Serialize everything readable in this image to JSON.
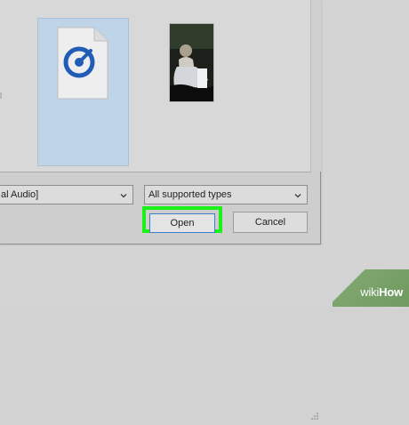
{
  "dialog": {
    "file_type_left": "al Audio]",
    "file_type_right": "All supported types",
    "open_label": "Open",
    "cancel_label": "Cancel"
  },
  "files": {
    "items": [
      {
        "kind": "document",
        "selected": true
      },
      {
        "kind": "video-thumbnail",
        "selected": false
      }
    ]
  },
  "watermark": {
    "left": "wiki",
    "right": "How"
  },
  "colors": {
    "selection": "#bfd4e6",
    "highlight": "#1af21a",
    "wikihow_green": "#7ea56e"
  },
  "icons": {
    "file_icon": "music-file-icon",
    "dropdown_icon": "chevron-down-icon",
    "resize_icon": "resize-grip-icon"
  }
}
